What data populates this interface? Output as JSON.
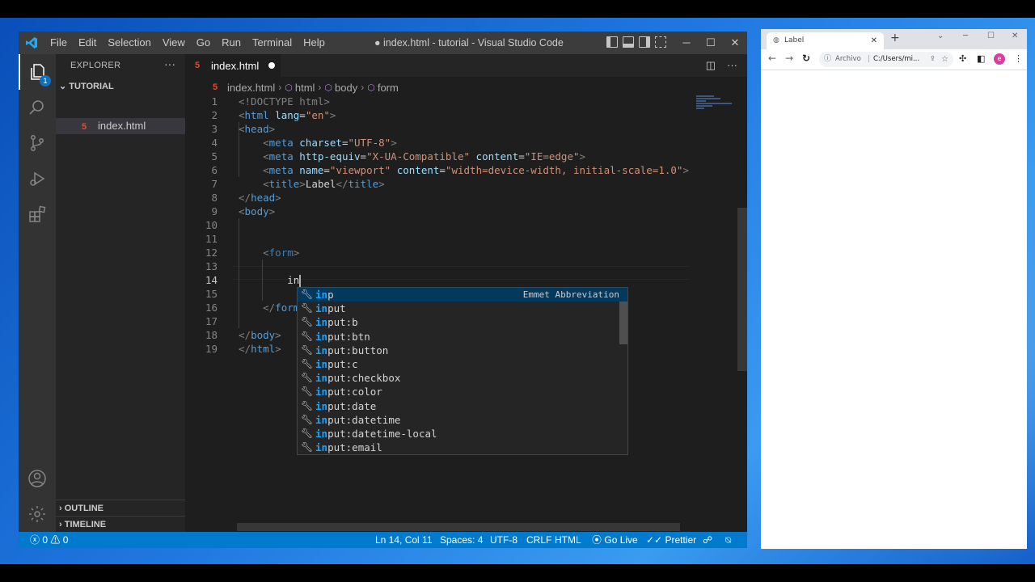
{
  "vscode": {
    "menu": [
      "File",
      "Edit",
      "Selection",
      "View",
      "Go",
      "Run",
      "Terminal",
      "Help"
    ],
    "window_title": "● index.html - tutorial - Visual Studio Code",
    "window_controls": [
      "─",
      "☐",
      "✕"
    ],
    "explorer_badge": "1",
    "sidebar": {
      "header": "EXPLORER",
      "more": "···",
      "folder": "TUTORIAL",
      "file": "index.html",
      "outline": "OUTLINE",
      "timeline": "TIMELINE"
    },
    "tab": {
      "label": "index.html"
    },
    "breadcrumb": [
      "index.html",
      "html",
      "body",
      "form"
    ],
    "line_numbers": [
      "1",
      "2",
      "3",
      "4",
      "5",
      "6",
      "7",
      "8",
      "9",
      "10",
      "11",
      "12",
      "13",
      "14",
      "15",
      "16",
      "17",
      "18",
      "19"
    ],
    "code": {
      "l1": "<!DOCTYPE html>",
      "l2_tag": "html",
      "l2_attr": "lang",
      "l2_val": "\"en\"",
      "l3_tag": "head",
      "l4_tag": "meta",
      "l4_attr": "charset",
      "l4_val": "\"UTF-8\"",
      "l5_tag": "meta",
      "l5_attr1": "http-equiv",
      "l5_val1": "\"X-UA-Compatible\"",
      "l5_attr2": "content",
      "l5_val2": "\"IE=edge\"",
      "l6_tag": "meta",
      "l6_attr1": "name",
      "l6_val1": "\"viewport\"",
      "l6_attr2": "content",
      "l6_val2": "\"width=device-width, initial-scale=1.0\"",
      "l7_tag": "title",
      "l7_text": "Label",
      "l7_close": "title",
      "l8_tag": "head",
      "l9_tag": "body",
      "l12_tag": "form",
      "l14_text": "in",
      "l16_tag": "form",
      "l18_tag": "body",
      "l19_tag": "html"
    },
    "suggestions": {
      "detail": "Emmet Abbreviation",
      "match": "in",
      "items": [
        "p",
        "put",
        "put:b",
        "put:btn",
        "put:button",
        "put:c",
        "put:checkbox",
        "put:color",
        "put:date",
        "put:datetime",
        "put:datetime-local",
        "put:email"
      ]
    },
    "status": {
      "problems": "0",
      "warnings": "0",
      "position": "Ln 14, Col 11",
      "spaces": "Spaces: 4",
      "encoding": "UTF-8",
      "eol": "CRLF",
      "language": "HTML",
      "golive": "Go Live",
      "prettier": "Prettier"
    }
  },
  "chrome": {
    "tab_title": "Label",
    "address_prefix": "Archivo",
    "address": "C:/Users/mi...",
    "avatar_letter": "e"
  }
}
